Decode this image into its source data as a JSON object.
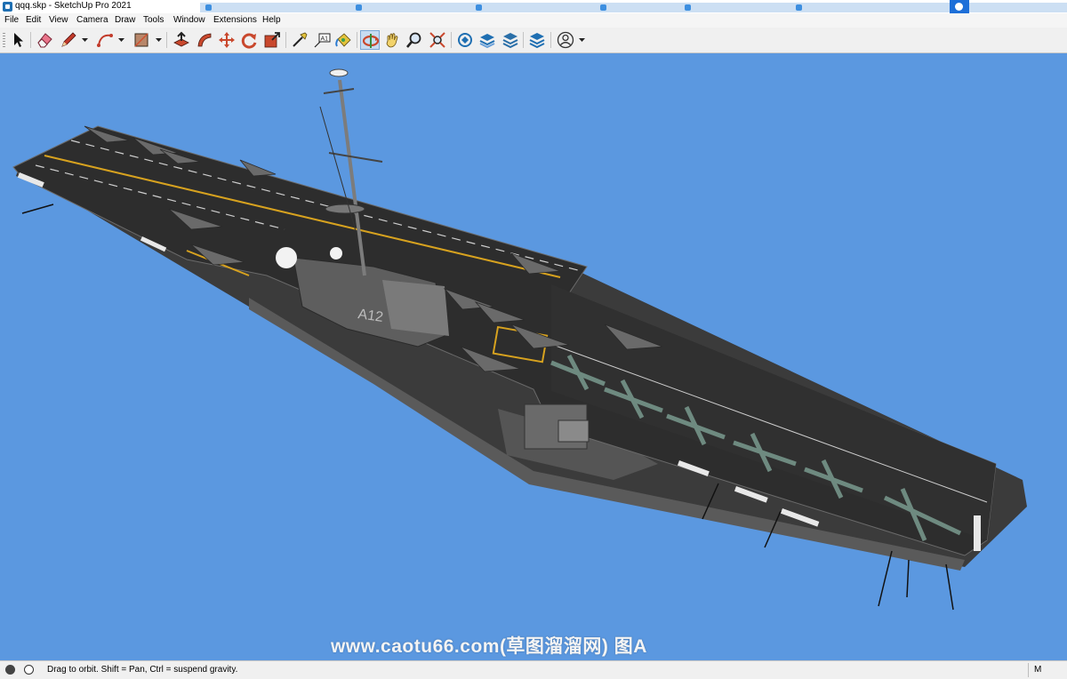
{
  "window": {
    "title": "qqq.skp - SketchUp Pro 2021"
  },
  "menu": [
    "File",
    "Edit",
    "View",
    "Camera",
    "Draw",
    "Tools",
    "Window",
    "Extensions",
    "Help"
  ],
  "toolbar": {
    "tools": [
      {
        "name": "select-tool",
        "icon": "arrow-cursor-icon"
      },
      {
        "name": "eraser-tool",
        "icon": "eraser-icon"
      },
      {
        "name": "line-tool",
        "icon": "pencil-icon"
      },
      {
        "name": "arc-tool",
        "icon": "arc-icon"
      },
      {
        "name": "shapes-tool",
        "icon": "rectangle-icon"
      },
      {
        "name": "push-pull-tool",
        "icon": "push-pull-icon"
      },
      {
        "name": "follow-me-tool",
        "icon": "follow-me-icon"
      },
      {
        "name": "move-tool",
        "icon": "move-icon"
      },
      {
        "name": "rotate-tool",
        "icon": "rotate-icon"
      },
      {
        "name": "scale-tool",
        "icon": "scale-icon"
      },
      {
        "name": "tape-measure-tool",
        "icon": "tape-measure-icon"
      },
      {
        "name": "text-tool",
        "icon": "text-icon",
        "label": "A1"
      },
      {
        "name": "paint-bucket-tool",
        "icon": "paint-bucket-icon"
      },
      {
        "name": "orbit-tool",
        "icon": "orbit-icon",
        "active": true
      },
      {
        "name": "pan-tool",
        "icon": "hand-icon"
      },
      {
        "name": "zoom-tool",
        "icon": "magnifier-icon"
      },
      {
        "name": "zoom-extents-tool",
        "icon": "zoom-extents-icon"
      },
      {
        "name": "3d-warehouse",
        "icon": "warehouse-icon"
      },
      {
        "name": "extension-warehouse",
        "icon": "extension-warehouse-icon"
      },
      {
        "name": "layout",
        "icon": "layout-icon"
      },
      {
        "name": "extension-manager",
        "icon": "extension-manager-icon"
      },
      {
        "name": "account",
        "icon": "user-icon"
      }
    ]
  },
  "scene": {
    "background": "#5b98e0",
    "hull_marking": "A12"
  },
  "watermark": "www.caotu66.com(草图溜溜网) 图A",
  "status": {
    "hint": "Drag to orbit. Shift = Pan, Ctrl = suspend gravity.",
    "measurements_label": "M"
  }
}
